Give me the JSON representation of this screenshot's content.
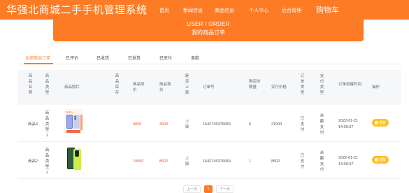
{
  "header": {
    "site_title": "华强北商城二手手机管理系统",
    "nav": [
      "首页",
      "新闻信息",
      "商品信息",
      "个人中心",
      "后台管理"
    ],
    "cart": "购物车"
  },
  "banner": {
    "line1": "USER / ORDER",
    "line2": "我的商品订单"
  },
  "tabs": [
    "全部商品订单",
    "已评价",
    "已收货",
    "已发货",
    "已支付",
    "退款"
  ],
  "active_tab": "全部商品订单",
  "table": {
    "headers": {
      "name": "商品名称",
      "type": "商品类型",
      "photo": "商品照片",
      "stock": "商品库存",
      "original_price": "商品原价",
      "current_price": "商品现价",
      "listed": "是否上架",
      "order_no": "订单号",
      "quantity": "购买的数量",
      "paid": "实付价格",
      "order_type": "订单类型",
      "pay_type": "支付类型",
      "created": "订单创建时间",
      "action": "操作"
    },
    "rows": [
      {
        "name": "商品4",
        "type": "商品类型1",
        "original_price": "4050",
        "current_price": "3500",
        "listed": "上架",
        "order_no": "1642745376689",
        "quantity": "6",
        "paid": "21000",
        "order_type": "已支付",
        "pay_type": "余额支付",
        "created_date": "2022-01-21",
        "created_time": "14:09:37",
        "action": "退款"
      },
      {
        "name": "商品2",
        "type": "商品类型2",
        "original_price": "10000",
        "current_price": "8502",
        "listed": "上架",
        "order_no": "1642745376689",
        "quantity": "1",
        "paid": "8502",
        "order_type": "已支付",
        "pay_type": "余额支付",
        "created_date": "2022-01-21",
        "created_time": "14:09:37",
        "action": "退款"
      }
    ]
  },
  "pagination": {
    "prev": "上一页",
    "current": "1",
    "next": "下一页"
  },
  "colors": {
    "primary": "#fd7b24",
    "price": "#f0522f",
    "action_button": "#fcc12a"
  },
  "icons": {
    "refund": "refund-icon",
    "product_1": "phone-product-icon",
    "product_2": "phone-product-icon"
  }
}
